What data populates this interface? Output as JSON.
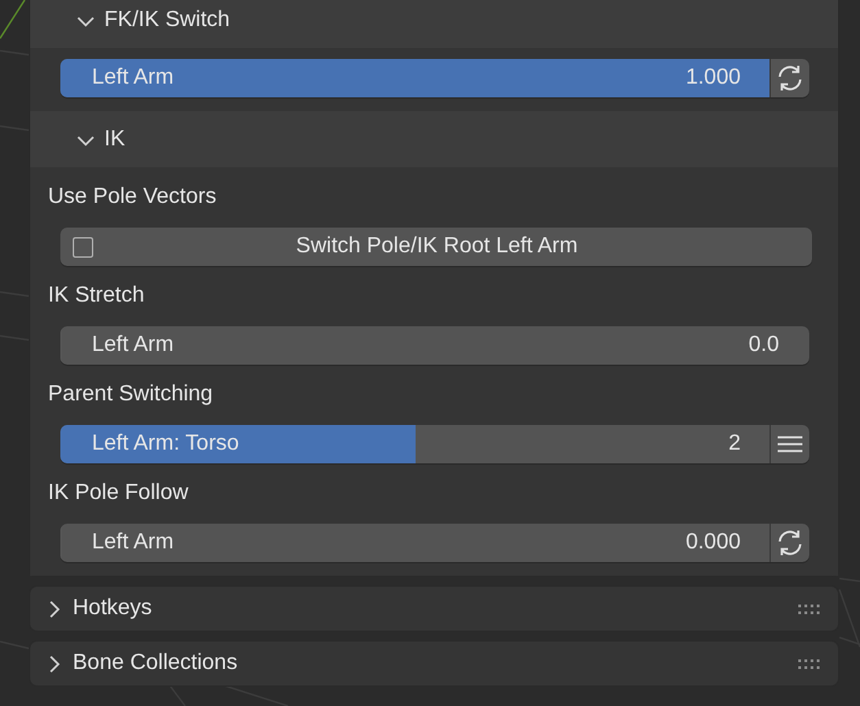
{
  "sections": [
    {
      "title": "FK/IK Switch",
      "expanded": true,
      "rows": [
        {
          "kind": "switcher",
          "label": "Left Arm",
          "value": "1.000",
          "level": 1
        }
      ]
    },
    {
      "title": "IK",
      "expanded": true,
      "rows": [
        {
          "kind": "label",
          "label": "Use Pole Vectors"
        },
        {
          "kind": "toggle",
          "label": "Switch Pole/IK Root Left Arm",
          "checked": false
        },
        {
          "kind": "label",
          "label": "IK Stretch"
        },
        {
          "kind": "slider",
          "label": "Left Arm",
          "value": "0.0",
          "level": 0
        },
        {
          "kind": "label",
          "label": "Parent Switching"
        },
        {
          "kind": "enum",
          "label": "Left Arm: Torso",
          "value": "2",
          "level": 0.5
        },
        {
          "kind": "label",
          "label": "IK Pole Follow"
        },
        {
          "kind": "switcher",
          "label": "Left Arm",
          "value": "0.000",
          "level": 0
        }
      ]
    }
  ],
  "panels": [
    {
      "title": "Hotkeys",
      "expanded": false
    },
    {
      "title": "Bone Collections",
      "expanded": false
    }
  ]
}
